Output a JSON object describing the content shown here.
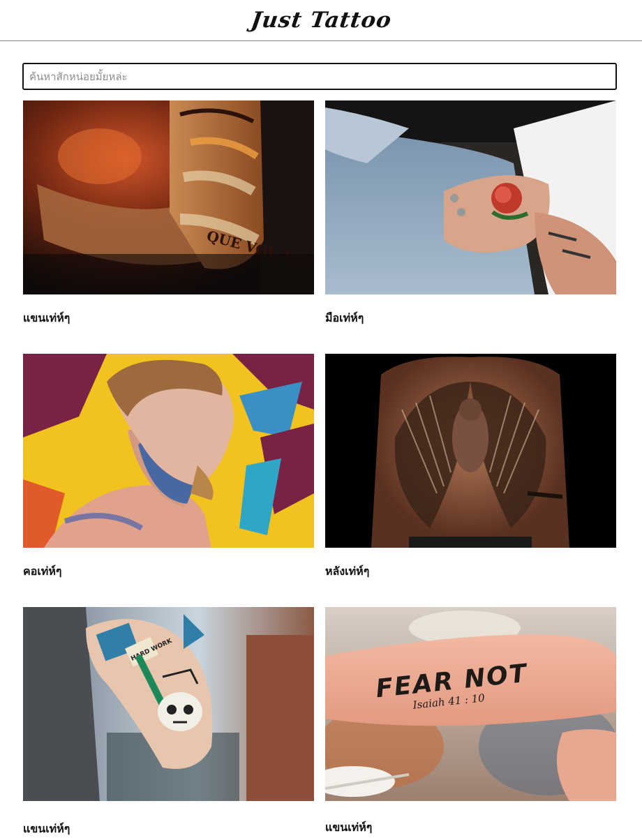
{
  "header": {
    "title": "Just Tattoo"
  },
  "search": {
    "placeholder": "ค้นหาสักหน่อยมั้ยหล่ะ",
    "value": ""
  },
  "gallery": {
    "items": [
      {
        "caption": "แขนเท่ห์ๆ",
        "image": "tattooed-forearm-photo"
      },
      {
        "caption": "มือเท่ห์ๆ",
        "image": "tattooed-hand-rose-photo"
      },
      {
        "caption": "คอเท่ห์ๆ",
        "image": "tattooed-neck-man-photo"
      },
      {
        "caption": "หลังเท่ห์ๆ",
        "image": "angel-wings-back-tattoo-photo"
      },
      {
        "caption": "แขนเท่ห์ๆ",
        "image": "skull-arm-tattoo-photo"
      },
      {
        "caption": "แขนเท่ห์ๆ",
        "image": "fear-not-forearm-tattoo-photo"
      }
    ],
    "photo_text": {
      "fear_not": "FEAR NOT",
      "verse": "Isaiah 41 : 10",
      "hard_work": "HARD WORK",
      "arm_script": "QUE VOU ENTAR"
    }
  }
}
